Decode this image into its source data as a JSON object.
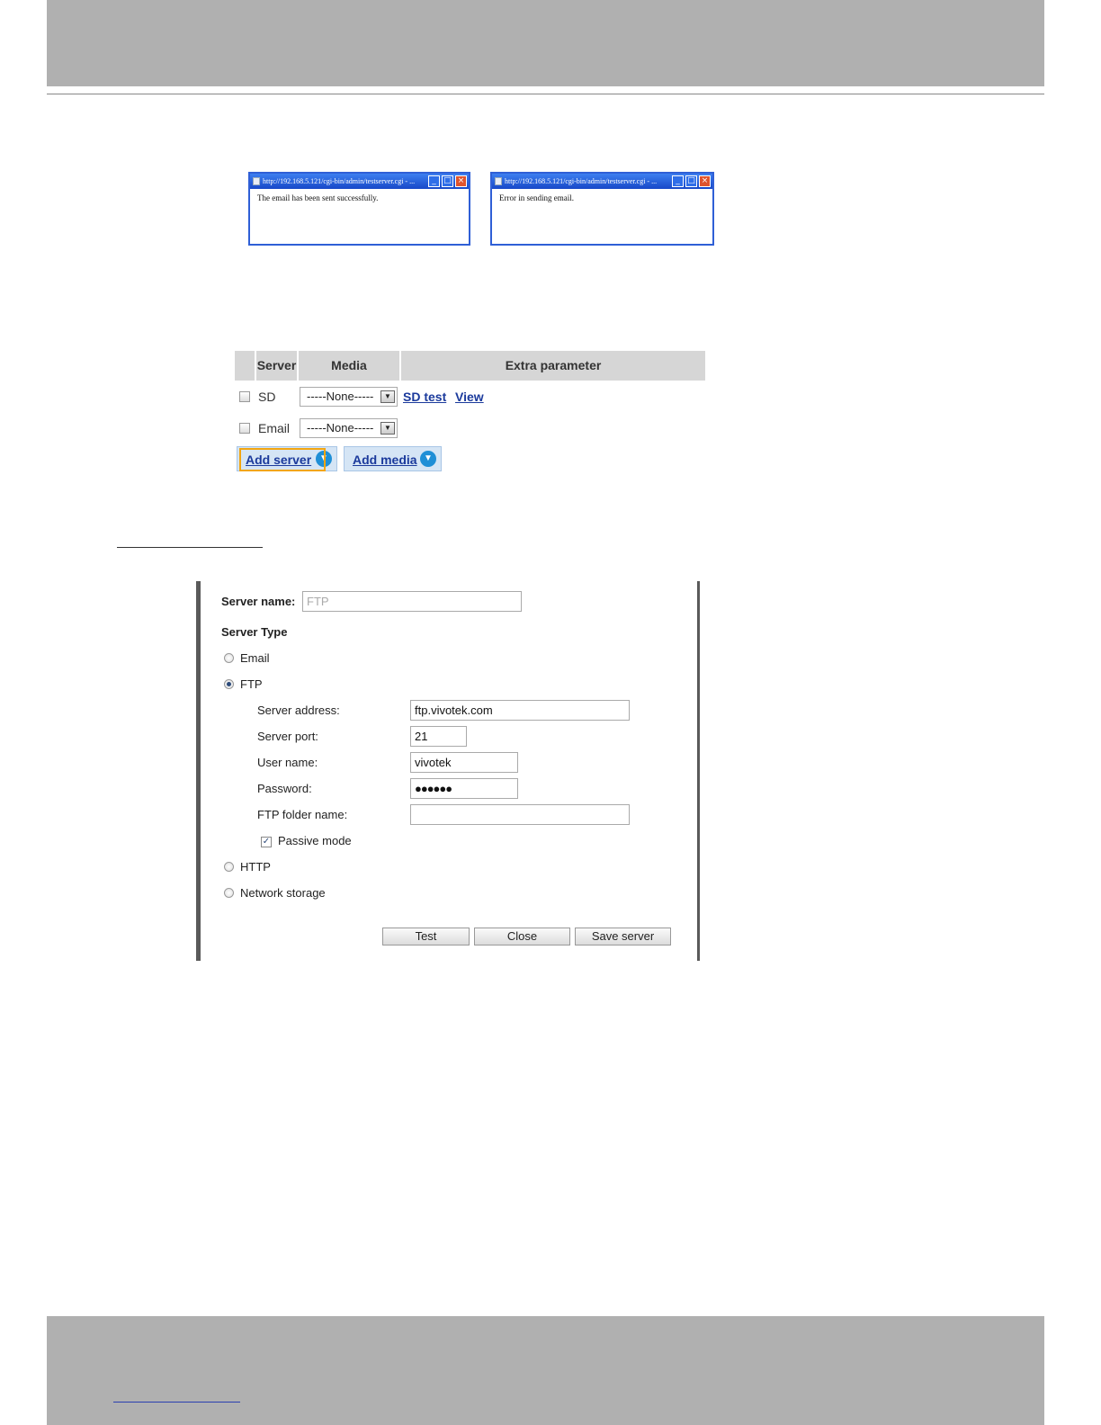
{
  "popups": {
    "success": {
      "title": "http://192.168.5.121/cgi-bin/admin/testserver.cgi - ...",
      "message": "The email has been sent successfully."
    },
    "error": {
      "title": "http://192.168.5.121/cgi-bin/admin/testserver.cgi - ...",
      "message": "Error in sending email."
    }
  },
  "server_table": {
    "headers": {
      "server": "Server",
      "media": "Media",
      "extra": "Extra parameter"
    },
    "rows": [
      {
        "server": "SD",
        "media": "-----None-----",
        "links": [
          "SD test",
          "View"
        ]
      },
      {
        "server": "Email",
        "media": "-----None-----"
      }
    ],
    "add_server": "Add server",
    "add_media": "Add media"
  },
  "ftp_dialog": {
    "server_name_label": "Server name:",
    "server_name_value": "FTP",
    "server_type_label": "Server Type",
    "types": {
      "email": "Email",
      "ftp": "FTP",
      "http": "HTTP",
      "network": "Network storage"
    },
    "selected_type": "FTP",
    "fields": {
      "address_label": "Server address:",
      "address_value": "ftp.vivotek.com",
      "port_label": "Server port:",
      "port_value": "21",
      "user_label": "User name:",
      "user_value": "vivotek",
      "password_label": "Password:",
      "password_value": "●●●●●●",
      "folder_label": "FTP folder name:",
      "folder_value": ""
    },
    "passive_mode": "Passive mode",
    "buttons": {
      "test": "Test",
      "close": "Close",
      "save": "Save server"
    }
  },
  "colors": {
    "band": "#b0b0b0",
    "link": "#1b3a9c",
    "accent_focus": "#f2a511",
    "popup_border": "#2f5fd6"
  }
}
